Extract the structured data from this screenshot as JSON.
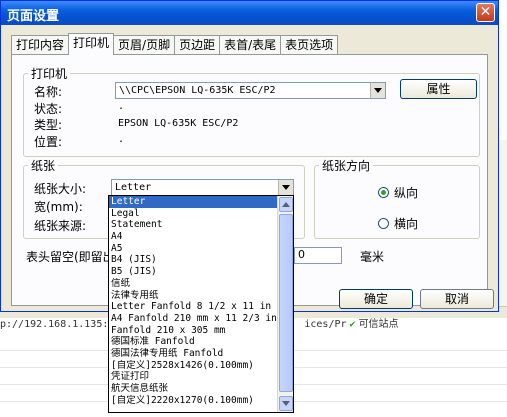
{
  "dialog": {
    "title": "页面设置",
    "close_glyph": "✕",
    "tabs": [
      "打印内容",
      "打印机",
      "页眉/页脚",
      "页边距",
      "表首/表尾",
      "表页选项"
    ],
    "active_tab": 1
  },
  "printer": {
    "group_label": "打印机",
    "name_label": "名称:",
    "name_value": "\\\\CPC\\EPSON LQ-635K ESC/P2",
    "properties_button": "属性",
    "status_label": "状态:",
    "status_value": ".",
    "type_label": "类型:",
    "type_value": "EPSON LQ-635K ESC/P2",
    "location_label": "位置:",
    "location_value": "."
  },
  "paper": {
    "group_label": "纸张",
    "size_label": "纸张大小:",
    "size_value": "Letter",
    "width_label": "宽(mm):",
    "source_label": "纸张来源:",
    "size_options": [
      "Letter",
      "Legal",
      "Statement",
      "A4",
      "A5",
      "B4 (JIS)",
      "B5 (JIS)",
      "信纸",
      "法律专用纸",
      "Letter Fanfold 8 1/2 x 11 in",
      "A4 Fanfold 210 mm x 11 2/3 in",
      "Fanfold 210 x 305 mm",
      "德国标准 Fanfold",
      "德国法律专用纸 Fanfold",
      "[自定义]2528x1426(0.100mm)",
      "凭证打印",
      "航天信息纸张",
      "[自定义]2220x1270(0.100mm)"
    ],
    "selected_index": 0
  },
  "orientation": {
    "group_label": "纸张方向",
    "portrait_label": "纵向",
    "landscape_label": "横向",
    "selected": "portrait"
  },
  "header_margin": {
    "label": "表头留空(即留出",
    "value": "0",
    "unit": "毫米"
  },
  "buttons": {
    "ok": "确定",
    "cancel": "取消"
  },
  "background": {
    "url_text": "p://192.168.1.135:",
    "url_suffix": "ices/Pr",
    "trusted_label": "可信站点",
    "trusted_glyph": "✔"
  },
  "colors": {
    "title_bar": "#0a5ddb",
    "selection": "#316ac5",
    "dialog_bg": "#ece9d8"
  }
}
